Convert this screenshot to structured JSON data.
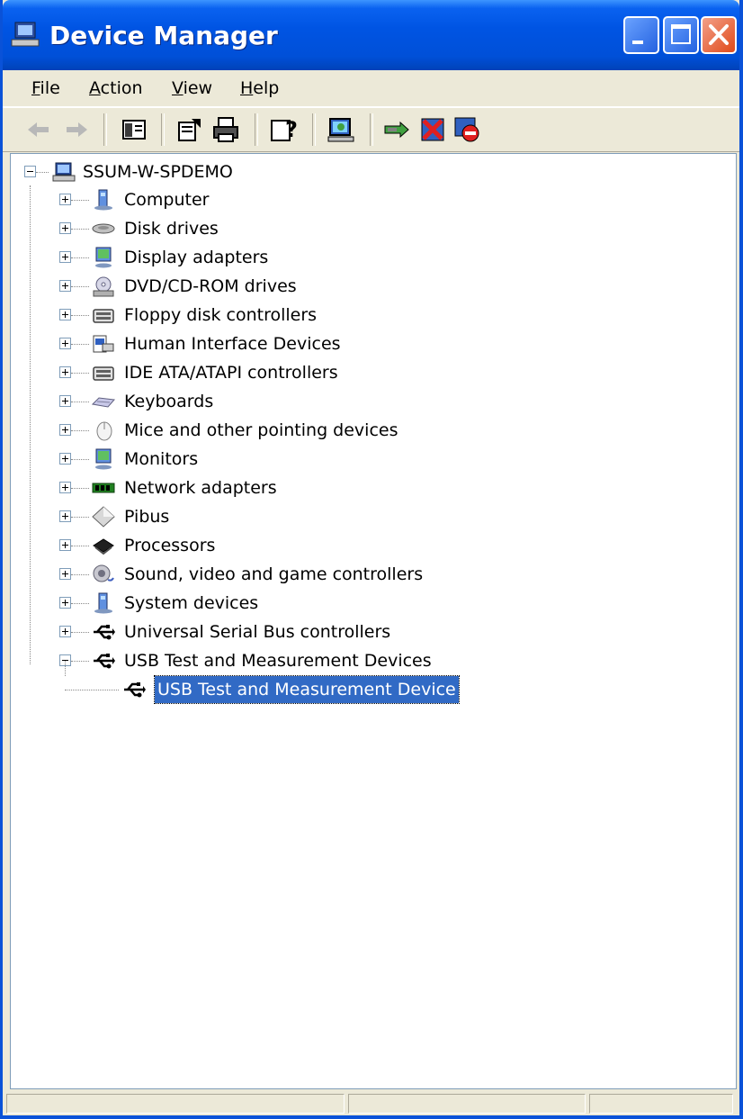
{
  "window": {
    "title": "Device Manager",
    "title_icon": "computer-icon"
  },
  "menu": [
    {
      "label": "File",
      "access_key": "F",
      "rest": "ile"
    },
    {
      "label": "Action",
      "access_key": "A",
      "rest": "ction"
    },
    {
      "label": "View",
      "access_key": "V",
      "rest": "iew"
    },
    {
      "label": "Help",
      "access_key": "H",
      "rest": "elp"
    }
  ],
  "toolbar": [
    "back-arrow-icon",
    "forward-arrow-icon",
    "show-hide-console-tree-icon",
    "properties-icon",
    "print-icon",
    "help-icon",
    "scan-hardware-icon",
    "update-driver-icon",
    "uninstall-icon",
    "disable-icon"
  ],
  "tree": {
    "root": "SSUM-W-SPDEMO",
    "categories": [
      {
        "label": "Computer",
        "icon": "computer-category-icon"
      },
      {
        "label": "Disk drives",
        "icon": "disk-drive-icon"
      },
      {
        "label": "Display adapters",
        "icon": "display-adapter-icon"
      },
      {
        "label": "DVD/CD-ROM drives",
        "icon": "dvd-drive-icon"
      },
      {
        "label": "Floppy disk controllers",
        "icon": "floppy-controller-icon"
      },
      {
        "label": "Human Interface Devices",
        "icon": "hid-icon"
      },
      {
        "label": "IDE ATA/ATAPI controllers",
        "icon": "ide-controller-icon"
      },
      {
        "label": "Keyboards",
        "icon": "keyboard-icon"
      },
      {
        "label": "Mice and other pointing devices",
        "icon": "mouse-icon"
      },
      {
        "label": "Monitors",
        "icon": "monitor-icon"
      },
      {
        "label": "Network adapters",
        "icon": "network-adapter-icon"
      },
      {
        "label": "Pibus",
        "icon": "pibus-icon"
      },
      {
        "label": "Processors",
        "icon": "processor-icon"
      },
      {
        "label": "Sound, video and game controllers",
        "icon": "sound-icon"
      },
      {
        "label": "System devices",
        "icon": "system-devices-icon"
      },
      {
        "label": "Universal Serial Bus controllers",
        "icon": "usb-icon"
      },
      {
        "label": "USB Test and Measurement Devices",
        "icon": "usb-icon",
        "expanded": true
      }
    ],
    "selected_device": "USB Test and Measurement Device"
  },
  "colors": {
    "titlebar": "#0054e3",
    "selection": "#316ac5",
    "chrome": "#ece9d8"
  }
}
